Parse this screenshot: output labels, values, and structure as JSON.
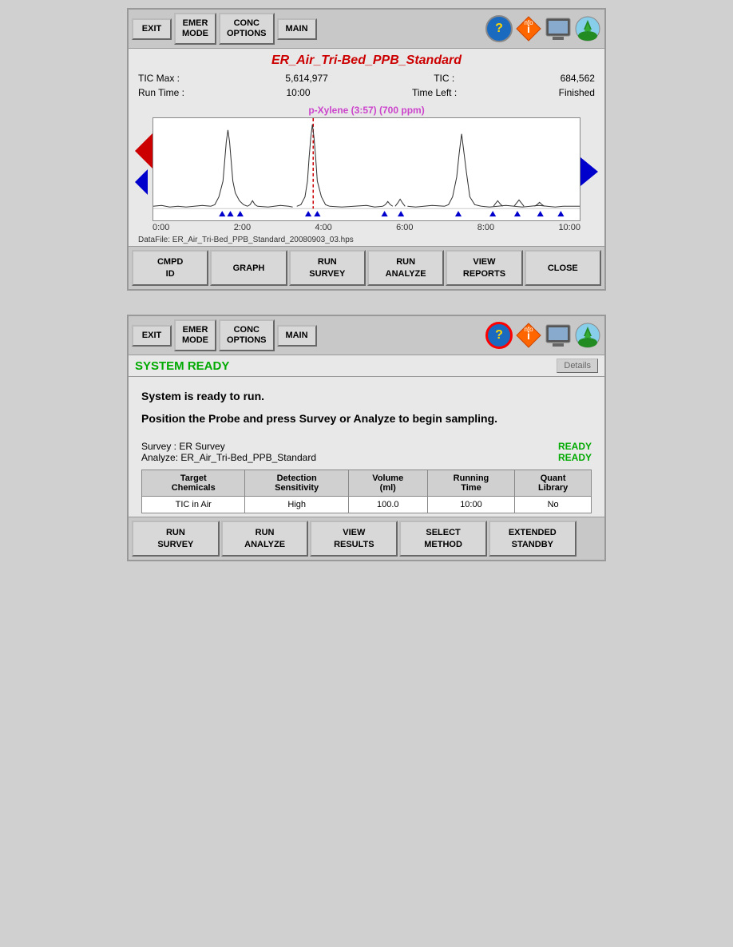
{
  "panel1": {
    "toolbar": {
      "exit": "EXIT",
      "emer_mode": "EMER\nMODE",
      "conc_options": "CONC\nOPTIONS",
      "main": "MAIN"
    },
    "title": "ER_Air_Tri-Bed_PPB_Standard",
    "tic_max_label": "TIC Max :",
    "tic_max_value": "5,614,977",
    "tic_label": "TIC :",
    "tic_value": "684,562",
    "run_time_label": "Run Time :",
    "run_time_value": "10:00",
    "time_left_label": "Time Left :",
    "time_left_value": "Finished",
    "chart_label": "p-Xylene (3:57) (700 ppm)",
    "xaxis": [
      "0:00",
      "2:00",
      "4:00",
      "6:00",
      "8:00",
      "10:00"
    ],
    "datafile": "DataFile: ER_Air_Tri-Bed_PPB_Standard_20080903_03.hps",
    "buttons": {
      "cmpd_id": "CMPD\nID",
      "graph": "GRAPH",
      "run_survey": "RUN\nSURVEY",
      "run_analyze": "RUN\nANALYZE",
      "view_reports": "VIEW\nREPORTS",
      "close": "CLOSE"
    }
  },
  "panel2": {
    "toolbar": {
      "exit": "EXIT",
      "emer_mode": "EMER\nMODE",
      "conc_options": "CONC\nOPTIONS",
      "main": "MAIN"
    },
    "status": "SYSTEM READY",
    "details_btn": "Details",
    "main_text1": "System is ready to run.",
    "main_text2": "Position the Probe and press Survey or Analyze to begin sampling.",
    "survey_label": "Survey  : ER Survey",
    "survey_status": "READY",
    "analyze_label": "Analyze: ER_Air_Tri-Bed_PPB_Standard",
    "analyze_status": "READY",
    "table": {
      "headers": [
        "Target\nChemicals",
        "Detection\nSensitivity",
        "Volume\n(ml)",
        "Running\nTime",
        "Quant\nLibrary"
      ],
      "row": [
        "TIC in Air",
        "High",
        "100.0",
        "10:00",
        "No"
      ]
    },
    "buttons": {
      "run_survey": "RUN\nSURVEY",
      "run_analyze": "RUN\nANALYZE",
      "view_results": "VIEW\nRESULTS",
      "select_method": "SELECT\nMETHOD",
      "extended_standby": "EXTENDED\nSTANDBY"
    }
  }
}
